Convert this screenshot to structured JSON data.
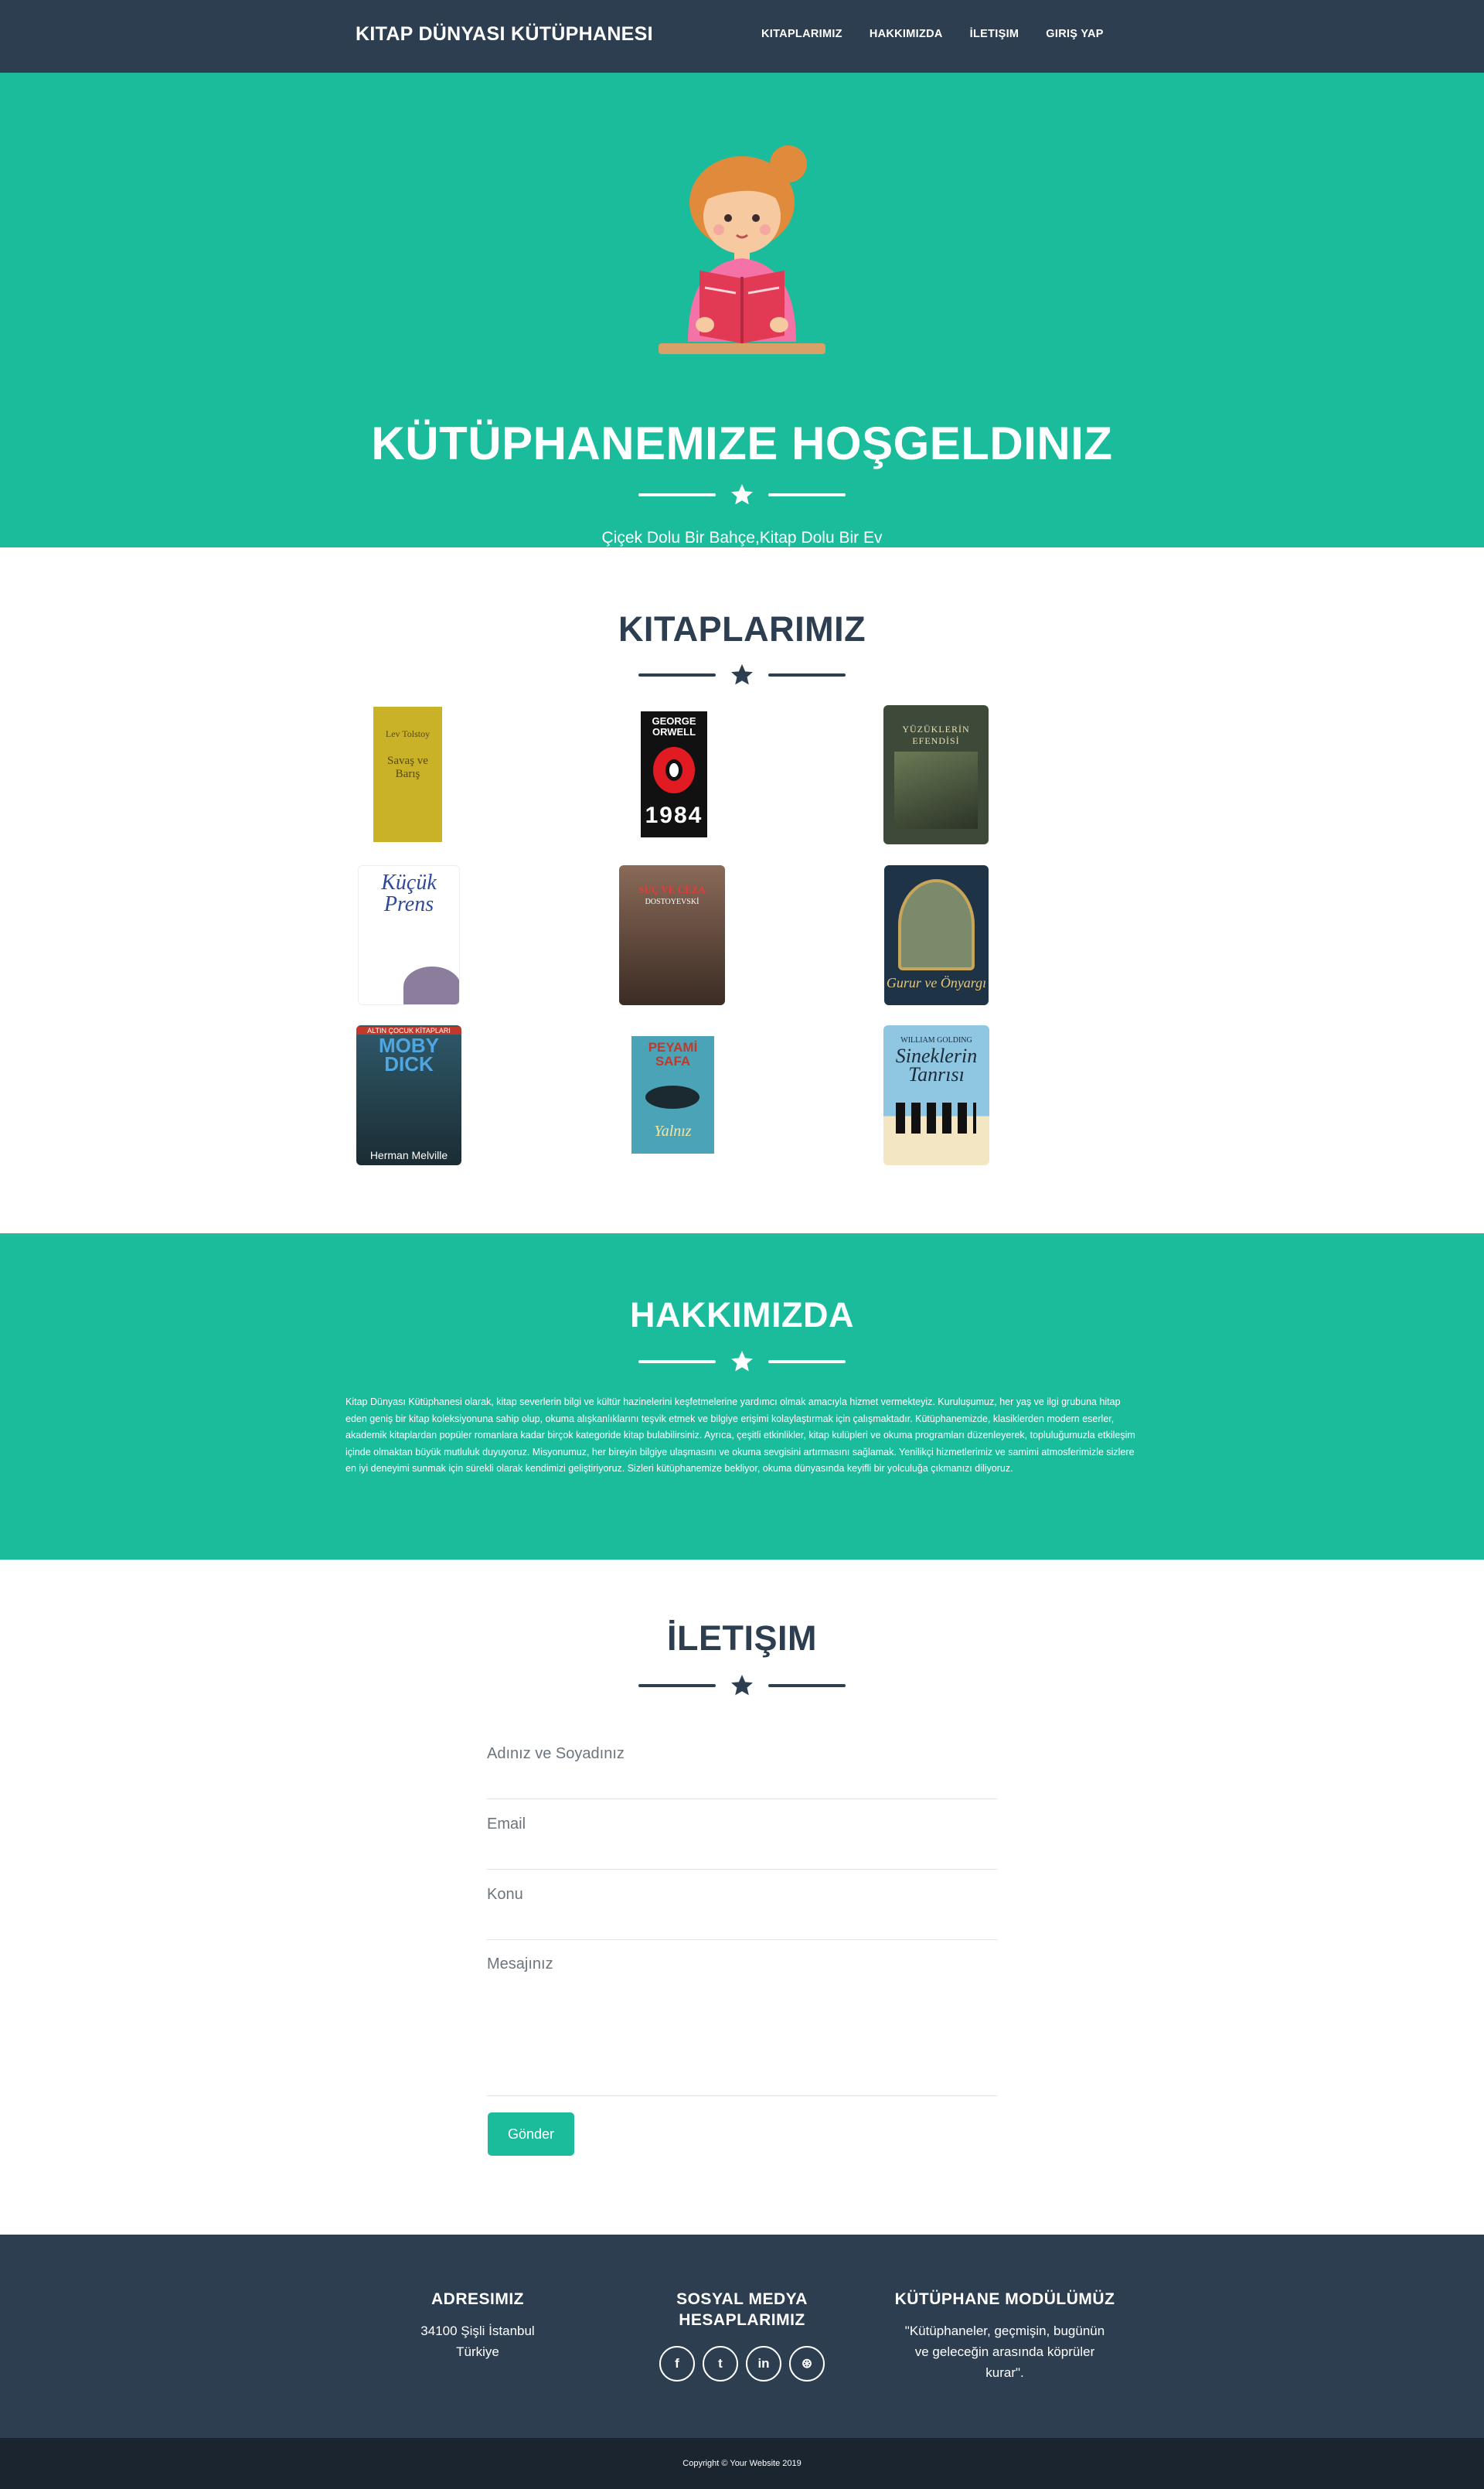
{
  "nav": {
    "brand": "KITAP DÜNYASI KÜTÜPHANESI",
    "links": [
      "KITAPLARIMIZ",
      "HAKKIMIZDA",
      "İLETIŞIM",
      "GIRIŞ YAP"
    ]
  },
  "hero": {
    "title": "KÜTÜPHANEMIZE HOŞGELDINIZ",
    "subtitle": "Çiçek Dolu Bir Bahçe,Kitap Dolu Bir Ev"
  },
  "books": {
    "title": "KITAPLARIMIZ",
    "items": [
      {
        "title": "Savaş ve Barış",
        "color": "#c9b227"
      },
      {
        "title": "1984 George Orwell",
        "color": "#111111"
      },
      {
        "title": "Yüzüklerin Efendisi",
        "color": "#3d4a3a"
      },
      {
        "title": "Küçük Prens",
        "color": "#ffffff"
      },
      {
        "title": "Suç ve Ceza Dostoyevski",
        "color": "#6b4a3a"
      },
      {
        "title": "Gurur ve Önyargı",
        "color": "#1f3347"
      },
      {
        "title": "Moby Dick Herman Melville",
        "color": "#3e6b7c"
      },
      {
        "title": "Peyami Safa Yalnız",
        "color": "#4ba3b8"
      },
      {
        "title": "Sineklerin Tanrısı William Golding",
        "color": "#7cb8d6"
      }
    ]
  },
  "about": {
    "title": "HAKKIMIZDA",
    "text": "Kitap Dünyası Kütüphanesi olarak, kitap severlerin bilgi ve kültür hazinelerini keşfetmelerine yardımcı olmak amacıyla hizmet vermekteyiz. Kuruluşumuz, her yaş ve ilgi grubuna hitap eden geniş bir kitap koleksiyonuna sahip olup, okuma alışkanlıklarını teşvik etmek ve bilgiye erişimi kolaylaştırmak için çalışmaktadır. Kütüphanemizde, klasiklerden modern eserler, akademik kitaplardan popüler romanlara kadar birçok kategoride kitap bulabilirsiniz. Ayrıca, çeşitli etkinlikler, kitap kulüpleri ve okuma programları düzenleyerek, topluluğumuzla etkileşim içinde olmaktan büyük mutluluk duyuyoruz. Misyonumuz, her bireyin bilgiye ulaşmasını ve okuma sevgisini artırmasını sağlamak. Yenilikçi hizmetlerimiz ve samimi atmosferimizle sizlere en iyi deneyimi sunmak için sürekli olarak kendimizi geliştiriyoruz. Sizleri kütüphanemize bekliyor, okuma dünyasında keyifli bir yolculuğa çıkmanızı diliyoruz."
  },
  "contact": {
    "title": "İLETIŞIM",
    "name_placeholder": "Adınız ve Soyadınız",
    "email_placeholder": "Email",
    "subject_placeholder": "Konu",
    "message_placeholder": "Mesajınız",
    "send_label": "Gönder"
  },
  "footer": {
    "address_title": "ADRESIMIZ",
    "address_line1": "34100 Şişli İstanbul",
    "address_line2": "Türkiye",
    "social_title": "SOSYAL MEDYA HESAPLARIMIZ",
    "socials": [
      "f",
      "t",
      "in",
      "⊛"
    ],
    "module_title": "KÜTÜPHANE MODÜLÜMÜZ",
    "quote": "\"Kütüphaneler, geçmişin, bugünün ve geleceğin arasında köprüler kurar\".",
    "copyright": "Copyright © Your Website 2019"
  },
  "colors": {
    "primary": "#1abc9c",
    "dark": "#2c3e50",
    "darker": "#1a252f"
  },
  "icons": [
    "star-icon",
    "reading-girl-illustration",
    "facebook-icon",
    "twitter-icon",
    "linkedin-icon",
    "dribbble-icon"
  ]
}
